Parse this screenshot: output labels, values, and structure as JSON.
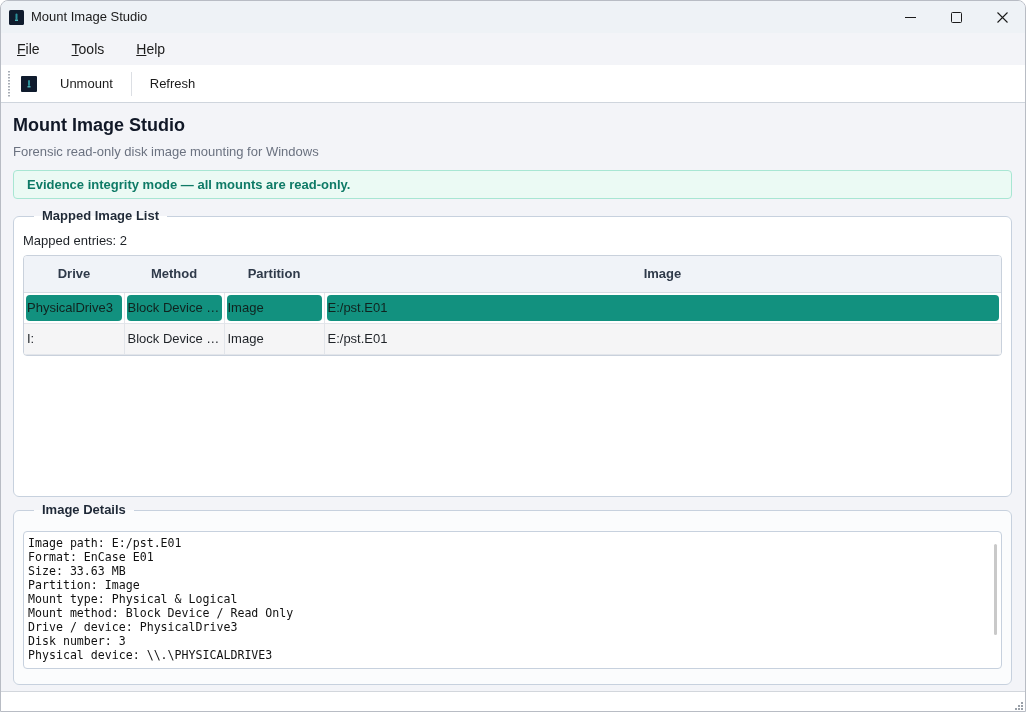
{
  "window": {
    "title": "Mount Image Studio"
  },
  "menu": [
    {
      "label": "File"
    },
    {
      "label": "Tools"
    },
    {
      "label": "Help"
    }
  ],
  "toolbar": {
    "buttons": [
      {
        "label": "Unmount"
      },
      {
        "label": "Refresh"
      }
    ]
  },
  "header": {
    "title": "Mount Image Studio",
    "subtitle": "Forensic read-only disk image mounting for Windows"
  },
  "notice": "Evidence integrity mode — all mounts are read-only.",
  "mapped_list": {
    "title": "Mapped Image List",
    "count": "Mapped entries: 2",
    "columns": [
      "Drive",
      "Method",
      "Partition",
      "Image"
    ],
    "rows": [
      {
        "selected": true,
        "cells": [
          "PhysicalDrive3",
          "Block Device …",
          "Image",
          "E:/pst.E01"
        ]
      },
      {
        "selected": false,
        "cells": [
          "I:",
          "Block Device …",
          "Image",
          "E:/pst.E01"
        ]
      }
    ]
  },
  "details": {
    "title": "Image Details",
    "lines": [
      "Image path: E:/pst.E01",
      "Format: EnCase E01",
      "Size: 33.63 MB",
      "Partition: Image",
      "Mount type: Physical & Logical",
      "Mount method: Block Device / Read Only",
      "Drive / device: PhysicalDrive3",
      "Disk number: 3",
      "Physical device: \\\\.\\PHYSICALDRIVE3"
    ]
  }
}
